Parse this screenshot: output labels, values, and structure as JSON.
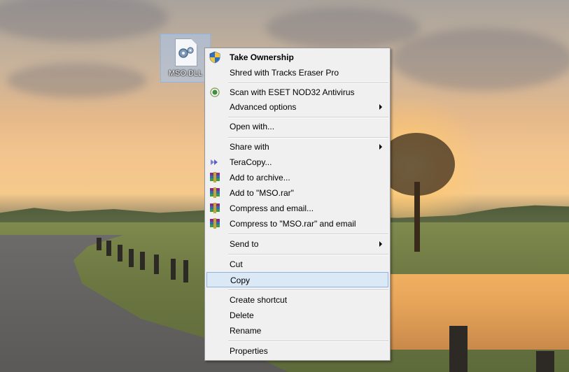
{
  "desktop": {
    "icon": {
      "label": "MSO.DLL",
      "icon_name": "dll-file-icon"
    }
  },
  "context_menu": {
    "items": [
      {
        "label": "Take Ownership",
        "icon": "uac-shield-icon",
        "bold": true
      },
      {
        "label": "Shred with Tracks Eraser Pro"
      },
      {
        "label": "Scan with ESET NOD32 Antivirus",
        "icon": "eset-icon"
      },
      {
        "label": "Advanced options",
        "submenu": true
      },
      {
        "label": "Open with..."
      },
      {
        "label": "Share with",
        "submenu": true
      },
      {
        "label": "TeraCopy...",
        "icon": "teracopy-icon"
      },
      {
        "label": "Add to archive...",
        "icon": "winrar-icon"
      },
      {
        "label": "Add to \"MSO.rar\"",
        "icon": "winrar-icon"
      },
      {
        "label": "Compress and email...",
        "icon": "winrar-icon"
      },
      {
        "label": "Compress to \"MSO.rar\" and email",
        "icon": "winrar-icon"
      },
      {
        "label": "Send to",
        "submenu": true
      },
      {
        "label": "Cut"
      },
      {
        "label": "Copy",
        "highlighted": true
      },
      {
        "label": "Create shortcut"
      },
      {
        "label": "Delete"
      },
      {
        "label": "Rename"
      },
      {
        "label": "Properties"
      }
    ]
  },
  "colors": {
    "menu_background": "#f0f0f0",
    "menu_border": "#979797",
    "highlight_background": "#dbe8f6",
    "highlight_border": "#8fb4de"
  }
}
